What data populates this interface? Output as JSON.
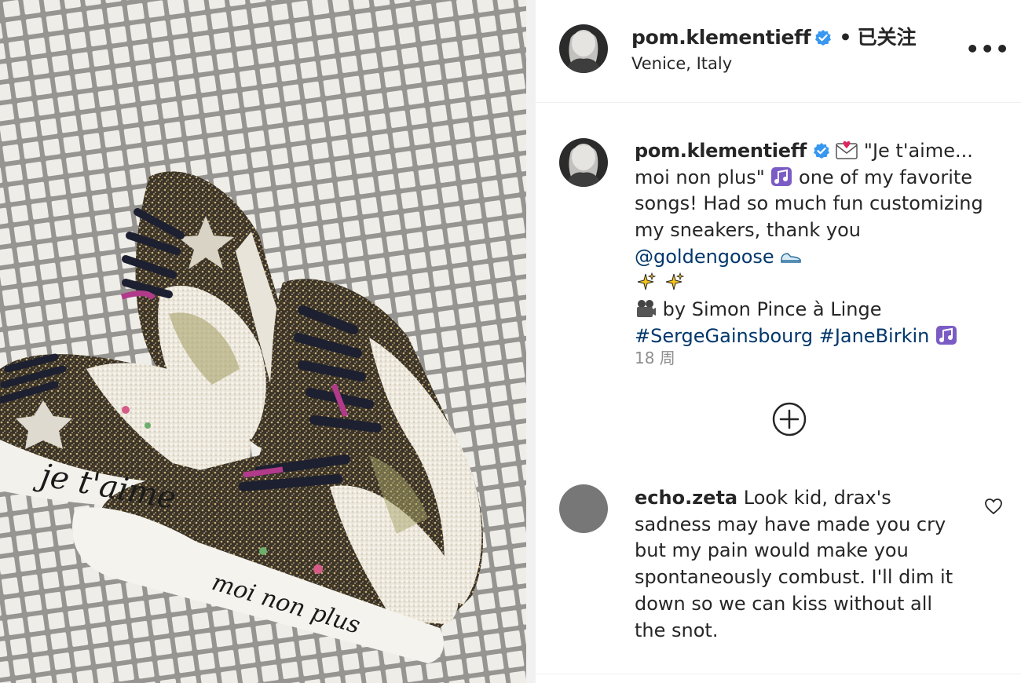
{
  "post": {
    "username": "pom.klementieff",
    "follow_status": "已关注",
    "separator": "•",
    "location": "Venice, Italy",
    "more_icon": "more-horizontal-icon",
    "image": {
      "shoe_text_left": "je t'aime",
      "shoe_text_right": "moi non plus"
    }
  },
  "caption": {
    "username": "pom.klementieff",
    "text_1": "\"Je t'aime... moi non plus\"",
    "text_2": "one of my favorite songs! Had so much fun customizing my sneakers, thank you",
    "mention": "@goldengoose",
    "text_3": "by Simon Pince à Linge",
    "hashtag_1": "#SergeGainsbourg",
    "hashtag_2": "#JaneBirkin",
    "time": "18 周"
  },
  "comment": {
    "username": "echo.zeta",
    "text": "Look kid, drax's sadness may have made you cry but my pain would make you spontaneously combust. I'll dim it down so we can kiss without all the snot."
  },
  "colors": {
    "verified": "#3897f0",
    "link": "#00376b",
    "muted": "#8e8e8e",
    "text": "#262626"
  }
}
